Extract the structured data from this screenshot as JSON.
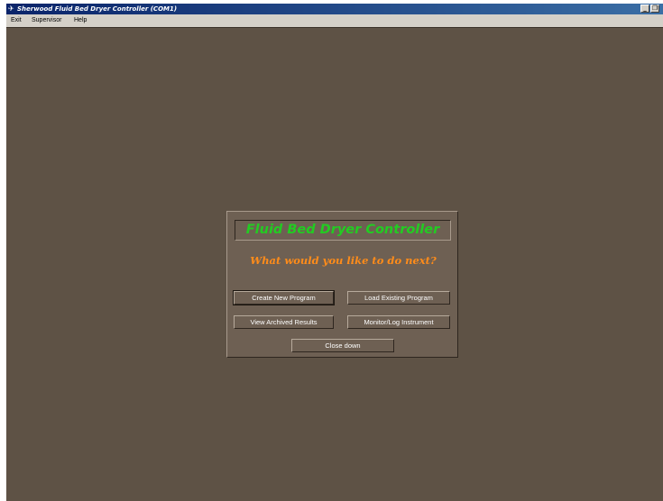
{
  "window": {
    "title": "Sherwood Fluid Bed Dryer Controller (COM1)",
    "minimize_glyph": "_",
    "restore_glyph": "❐"
  },
  "menu": [
    "Exit",
    "Supervisor",
    "Help"
  ],
  "dialog": {
    "heading": "Fluid Bed Dryer Controller",
    "prompt": "What would you like to do next?",
    "buttons": {
      "create": "Create New Program",
      "load": "Load Existing Program",
      "view": "View Archived Results",
      "monitor": "Monitor/Log Instrument",
      "close": "Close down"
    }
  },
  "colors": {
    "titlebar_start": "#0a246a",
    "titlebar_end": "#3a6ea5",
    "workspace": "#5e5245",
    "dialog": "#6e6053",
    "heading": "#22cc22",
    "prompt": "#ff8c1a",
    "button_text": "#ffffff"
  },
  "icons": {
    "app": "app-window-icon",
    "minimize": "minimize-icon",
    "restore": "restore-icon"
  }
}
